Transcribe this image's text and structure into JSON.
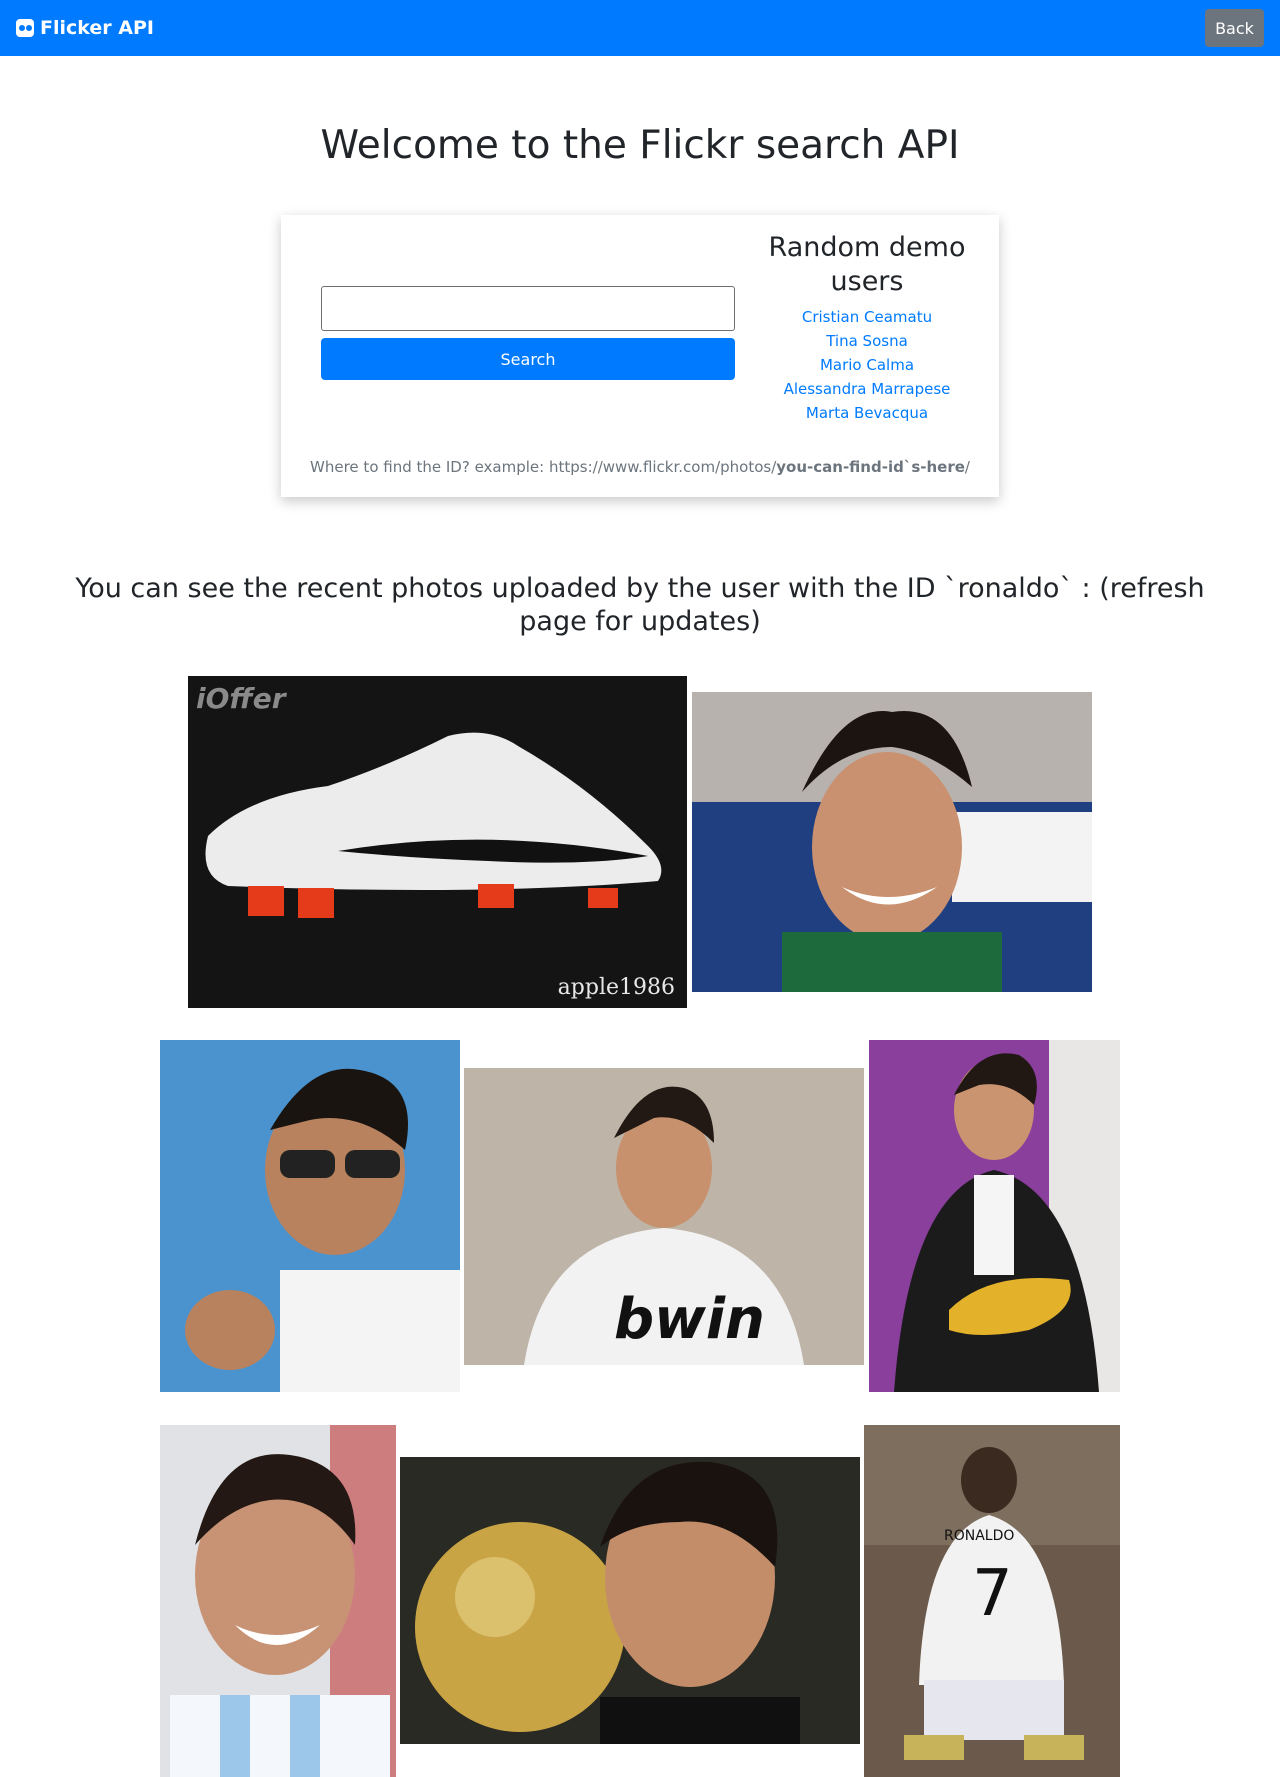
{
  "navbar": {
    "brand_icon": "flickr-icon",
    "brand_label": "Flicker API",
    "back_label": "Back",
    "accent_color": "#007bff"
  },
  "main": {
    "title": "Welcome to the Flickr search API"
  },
  "search": {
    "placeholder": "",
    "value": "",
    "button_label": "Search"
  },
  "demo_users": {
    "title": "Random demo users",
    "users": [
      "Cristian Ceamatu",
      "Tina Sosna",
      "Mario Calma",
      "Alessandra Marrapese",
      "Marta Bevacqua"
    ]
  },
  "help": {
    "prefix": "Where to find the ID? example: https://www.flickr.com/photos/",
    "highlight": "you-can-find-id`s-here",
    "suffix": "/"
  },
  "gallery": {
    "heading": "You can see the recent photos uploaded by the user with the ID `ronaldo` : (refresh page for updates)",
    "photos": [
      {
        "label": "apple1986",
        "bg": "#1a1a1a"
      },
      {
        "label": "",
        "bg": "#2f4f8a"
      },
      {
        "label": "",
        "bg": "#3e86c6"
      },
      {
        "label": "",
        "bg": "#b8a898"
      },
      {
        "label": "",
        "bg": "#7a3a8e"
      },
      {
        "label": "",
        "bg": "#cfd6de"
      },
      {
        "label": "",
        "bg": "#3a3a2a"
      },
      {
        "label": "",
        "bg": "#6a5a4a"
      }
    ]
  }
}
